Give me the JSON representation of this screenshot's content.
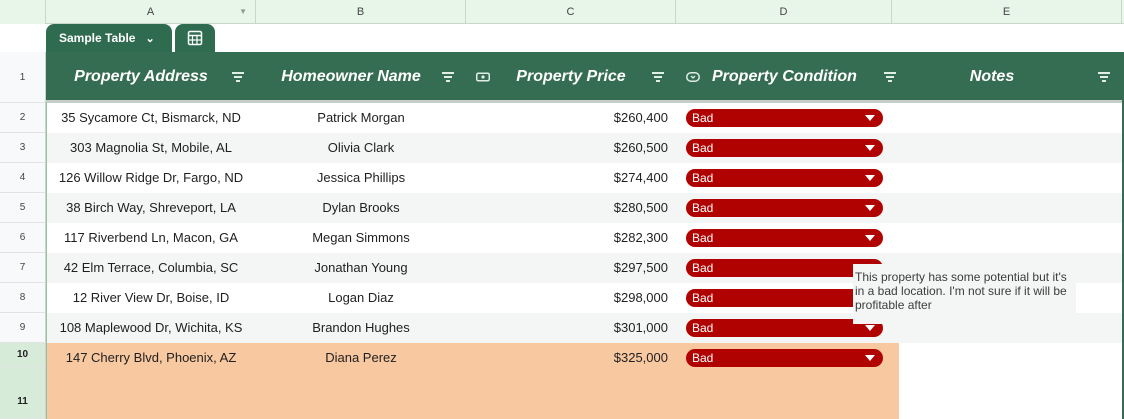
{
  "columns": [
    "A",
    "B",
    "C",
    "D",
    "E"
  ],
  "table_tab": {
    "name": "Sample Table",
    "chevron": "chevron-down-icon",
    "settings_icon": "table-settings-icon"
  },
  "headers": {
    "address": "Property Address",
    "owner": "Homeowner Name",
    "price": "Property Price",
    "condition": "Property Condition",
    "notes": "Notes"
  },
  "rows": [
    {
      "num": "2",
      "address": "35 Sycamore Ct, Bismarck, ND",
      "owner": "Patrick Morgan",
      "price": "$260,400",
      "condition": "Bad"
    },
    {
      "num": "3",
      "address": "303 Magnolia St, Mobile, AL",
      "owner": "Olivia Clark",
      "price": "$260,500",
      "condition": "Bad"
    },
    {
      "num": "4",
      "address": "126 Willow Ridge Dr, Fargo, ND",
      "owner": "Jessica Phillips",
      "price": "$274,400",
      "condition": "Bad"
    },
    {
      "num": "5",
      "address": "38 Birch Way, Shreveport, LA",
      "owner": "Dylan Brooks",
      "price": "$280,500",
      "condition": "Bad"
    },
    {
      "num": "6",
      "address": "117 Riverbend Ln, Macon, GA",
      "owner": "Megan Simmons",
      "price": "$282,300",
      "condition": "Bad"
    },
    {
      "num": "7",
      "address": "42 Elm Terrace, Columbia, SC",
      "owner": "Jonathan Young",
      "price": "$297,500",
      "condition": "Bad"
    },
    {
      "num": "8",
      "address": "12 River View Dr, Boise, ID",
      "owner": "Logan Diaz",
      "price": "$298,000",
      "condition": "Bad"
    },
    {
      "num": "9",
      "address": "108 Maplewood Dr, Wichita, KS",
      "owner": "Brandon Hughes",
      "price": "$301,000",
      "condition": "Bad"
    },
    {
      "num": "10",
      "address": "147 Cherry Blvd, Phoenix, AZ",
      "owner": "Diana Perez",
      "price": "$325,000",
      "condition": "Bad"
    }
  ],
  "row_header_header": "1",
  "row_11": "11",
  "note_row_10": "This property has some potential but it's in a bad location. I'm not sure if it will be profitable after",
  "colors": {
    "header_bg": "#356d52",
    "chip_bad": "#b10202",
    "highlight": "#f8c8a0"
  }
}
